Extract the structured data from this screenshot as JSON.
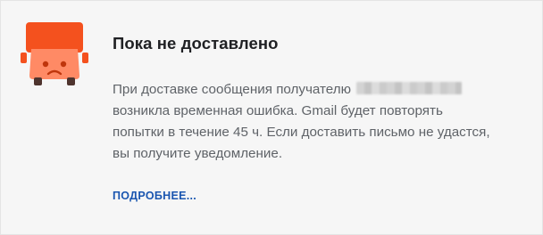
{
  "notice": {
    "title": "Пока не доставлено",
    "body_line_1": "При доставке сообщения получателю",
    "recipient_redacted": "",
    "body_line_2": "возникла временная ошибка. Gmail будет повторять",
    "body_line_3": "попытки в течение 45 ч. Если доставить письмо не удастся,",
    "body_line_4": "вы получите уведомление.",
    "more_link_label": "ПОДРОБНЕЕ..."
  },
  "icon": {
    "name": "delivery-truck-icon",
    "color": "#f4511e",
    "face_color": "#ff8a65"
  },
  "colors": {
    "title": "#202124",
    "body": "#5f6368",
    "link": "#1a56b0",
    "background": "#f6f6f6"
  }
}
